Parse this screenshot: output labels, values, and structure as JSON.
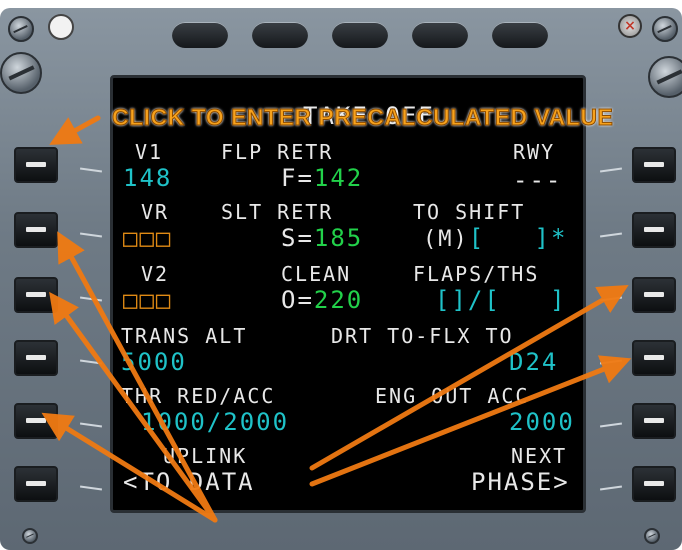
{
  "annotation": {
    "callout": "CLICK TO ENTER PRECALCULATED VALUE",
    "color": "#f7a21c"
  },
  "title": "TAKE OFF",
  "rows": {
    "l1_label": "V1",
    "l1_value": "148",
    "c1_label": "FLP RETR",
    "c1_prefix": "F=",
    "c1_value": "142",
    "r1_label": "RWY",
    "r1_value": "---",
    "l2_label": "VR",
    "l2_value": "□□□",
    "c2_label": "SLT RETR",
    "c2_prefix": "S=",
    "c2_value": "185",
    "r2_label": "TO SHIFT",
    "r2_prefix": "(M)",
    "r2_value": "[   ]*",
    "l3_label": "V2",
    "l3_value": "□□□",
    "c3_label": "CLEAN",
    "c3_prefix": "O=",
    "c3_value": "220",
    "r3_label": "FLAPS/THS",
    "r3_value": "[]/[   ]",
    "l4_label": "TRANS ALT",
    "l4_value": "5000",
    "r4_label": "DRT TO-FLX TO",
    "r4_value": "D24",
    "l5_label": "THR RED/ACC",
    "l5_value": "1000/2000",
    "r5_label": "ENG OUT ACC",
    "r5_value": "2000",
    "l6_label": "UPLINK",
    "l6_value": "<TO DATA",
    "r6_label": "NEXT",
    "r6_value": "PHASE>"
  },
  "colors": {
    "white": "#e8e8e8",
    "green": "#22d14a",
    "cyan": "#1fc2c8",
    "amber": "#e08a14"
  }
}
